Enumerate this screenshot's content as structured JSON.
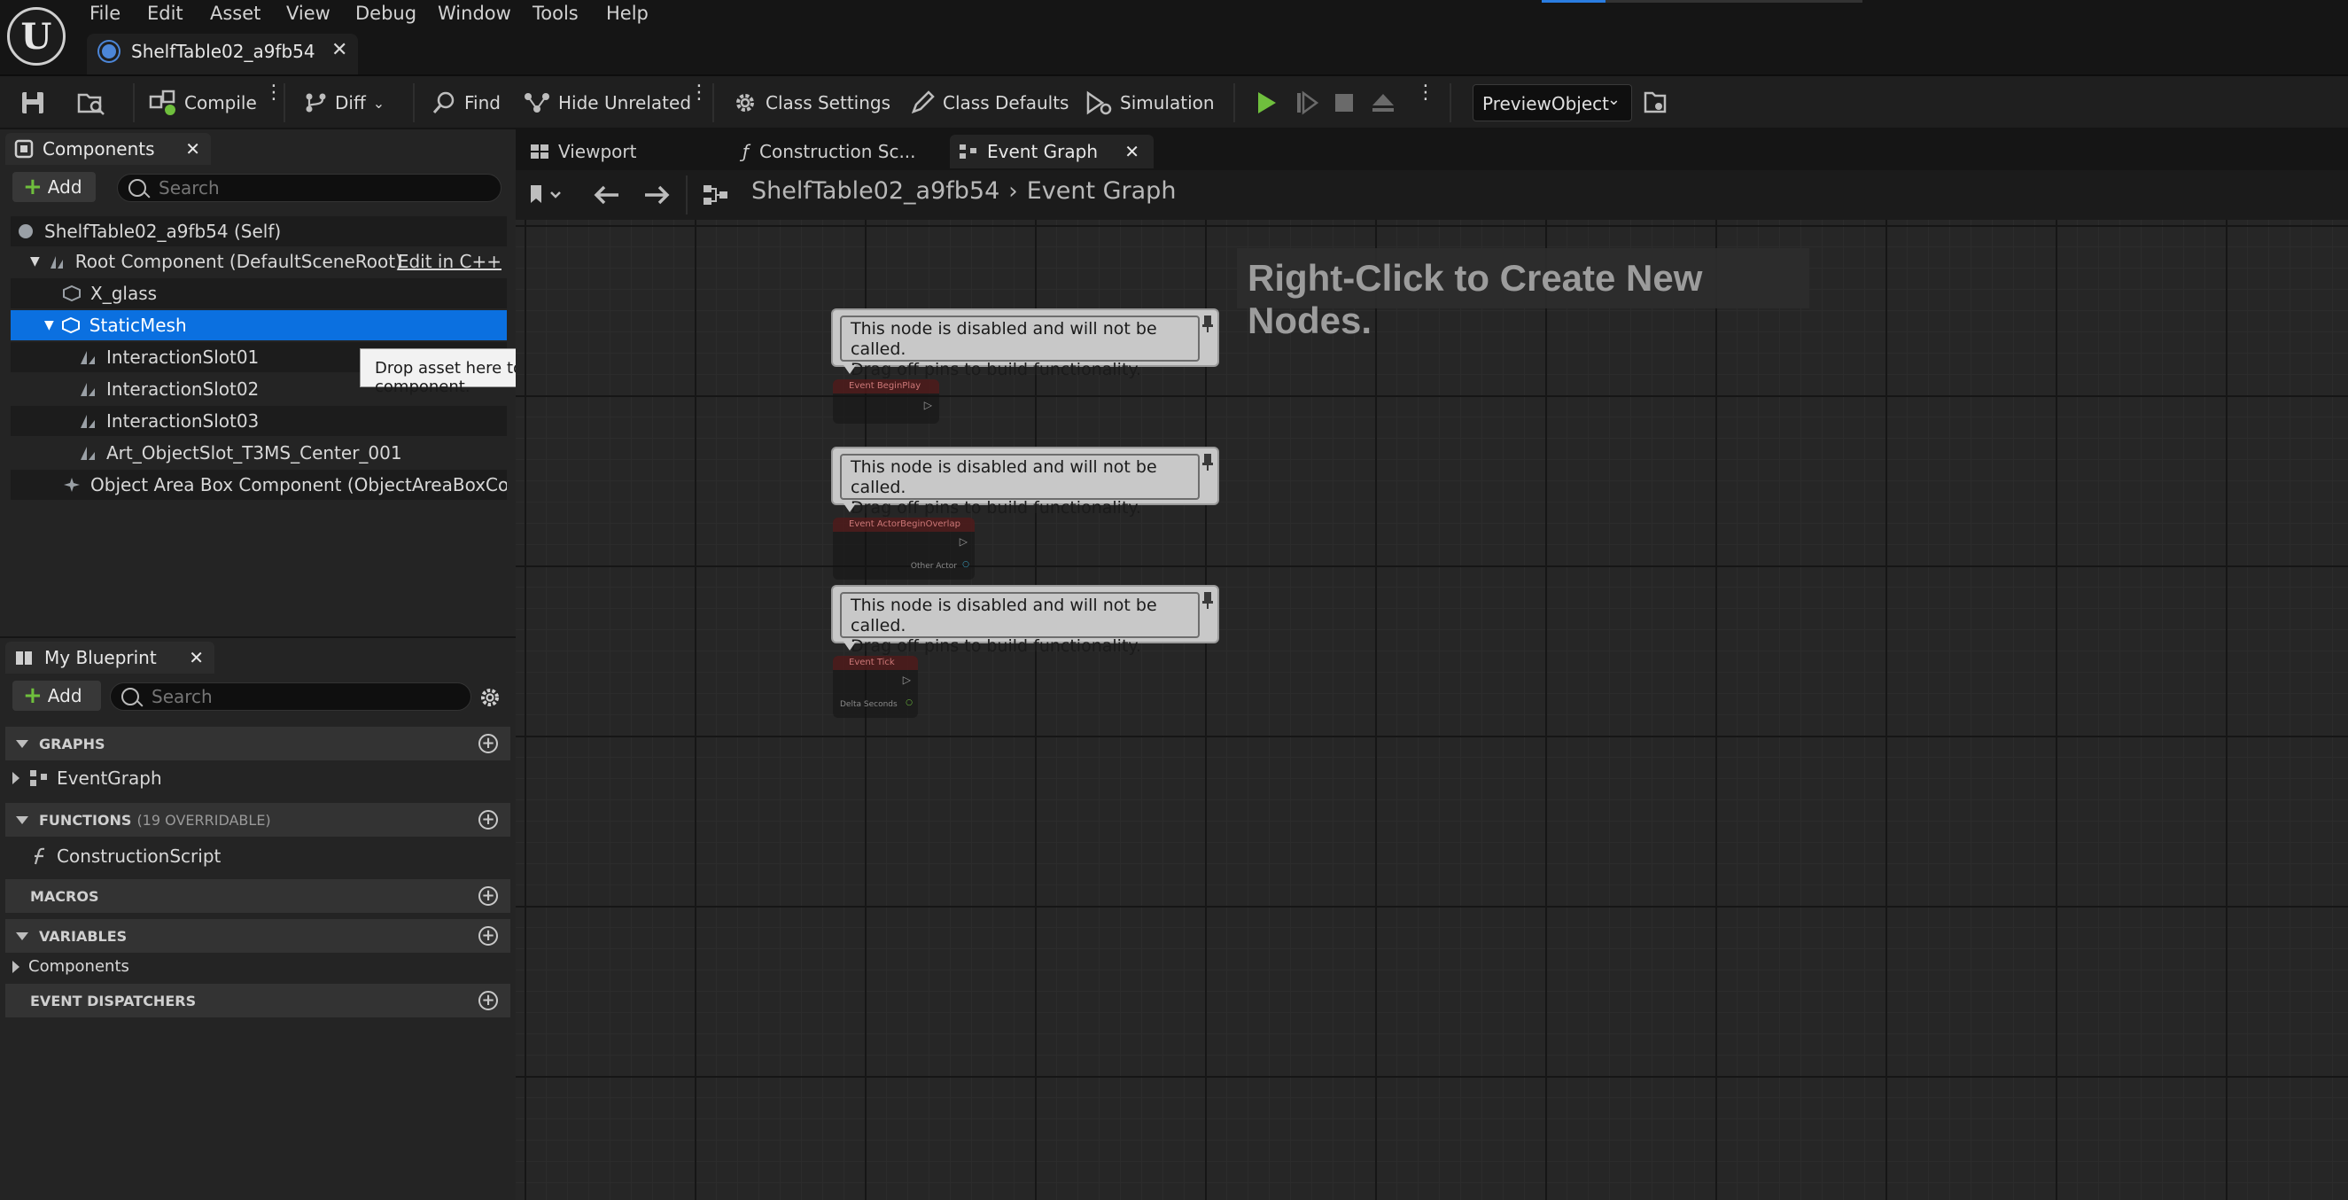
{
  "menu": {
    "items": [
      "File",
      "Edit",
      "Asset",
      "View",
      "Debug",
      "Window",
      "Tools",
      "Help"
    ]
  },
  "document_tab": {
    "label": "ShelfTable02_a9fb54"
  },
  "toolbar": {
    "compile": "Compile",
    "diff": "Diff",
    "find": "Find",
    "hide_unrelated": "Hide Unrelated",
    "class_settings": "Class Settings",
    "class_defaults": "Class Defaults",
    "simulation": "Simulation",
    "preview_object": "PreviewObject"
  },
  "components": {
    "tab_label": "Components",
    "add_label": "Add",
    "search_placeholder": "Search",
    "edit_cpp": "Edit in C++",
    "tree": [
      {
        "label": "ShelfTable02_a9fb54 (Self)",
        "icon": "blueprint-self-icon"
      },
      {
        "label": "Root Component (DefaultSceneRoot)",
        "icon": "scene-root-icon"
      },
      {
        "label": "X_glass",
        "icon": "static-mesh-icon"
      },
      {
        "label": "StaticMesh",
        "icon": "static-mesh-icon",
        "selected": true
      },
      {
        "label": "InteractionSlot01",
        "icon": "slot-icon"
      },
      {
        "label": "InteractionSlot02",
        "icon": "slot-icon"
      },
      {
        "label": "InteractionSlot03",
        "icon": "slot-icon"
      },
      {
        "label": "Art_ObjectSlot_T3MS_Center_001",
        "icon": "slot-icon"
      },
      {
        "label": "Object Area Box Component (ObjectAreaBoxCompon",
        "icon": "box-component-icon"
      }
    ],
    "tooltip": "Drop asset here to add a component."
  },
  "my_blueprint": {
    "tab_label": "My Blueprint",
    "add_label": "Add",
    "search_placeholder": "Search",
    "graphs_label": "GRAPHS",
    "event_graph_item": "EventGraph",
    "functions_label": "FUNCTIONS",
    "functions_sub": "(19 OVERRIDABLE)",
    "construction_script_item": "ConstructionScript",
    "macros_label": "MACROS",
    "variables_label": "VARIABLES",
    "components_item": "Components",
    "event_dispatchers_label": "EVENT DISPATCHERS"
  },
  "graph_tabs": {
    "viewport": "Viewport",
    "construction": "Construction Sc...",
    "event_graph": "Event Graph"
  },
  "breadcrumb": {
    "blueprint": "ShelfTable02_a9fb54",
    "graph": "Event Graph"
  },
  "graph": {
    "hint": "Right-Click to Create New Nodes.",
    "disabled_note_line1": "This node is disabled and will not be called.",
    "disabled_note_line2": "Drag off pins to build functionality.",
    "nodes": [
      {
        "title": "Event BeginPlay",
        "pin": ""
      },
      {
        "title": "Event ActorBeginOverlap",
        "pin": "Other Actor"
      },
      {
        "title": "Event Tick",
        "pin": "Delta Seconds"
      }
    ]
  },
  "colors": {
    "accent_blue": "#0b70e0",
    "play_green": "#6fbf3d",
    "event_red": "#8a2a2a"
  }
}
